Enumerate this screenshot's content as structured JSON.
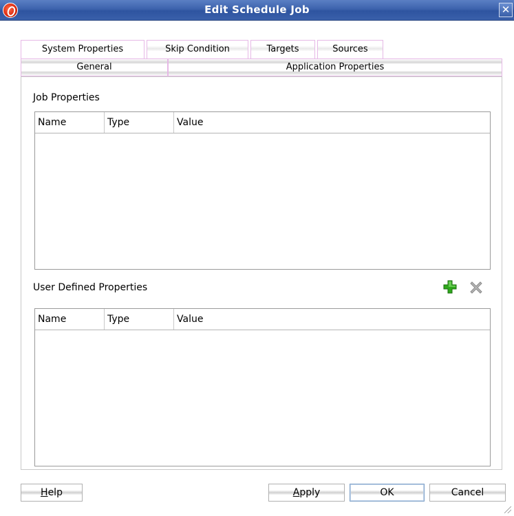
{
  "window": {
    "title": "Edit Schedule Job",
    "close_glyph": "✕",
    "app_icon": "oracle-logo-icon"
  },
  "tabs_row1": [
    {
      "label": "System Properties",
      "active": true
    },
    {
      "label": "Skip Condition",
      "active": false
    },
    {
      "label": "Targets",
      "active": false
    },
    {
      "label": "Sources",
      "active": false
    }
  ],
  "tabs_row2": [
    {
      "label": "General",
      "active": false
    },
    {
      "label": "Application Properties",
      "active": false
    }
  ],
  "job_properties": {
    "label": "Job Properties",
    "columns": [
      "Name",
      "Type",
      "Value"
    ],
    "rows": []
  },
  "user_defined_properties": {
    "label": "User Defined Properties",
    "columns": [
      "Name",
      "Type",
      "Value"
    ],
    "rows": [],
    "add_icon": "add-icon",
    "delete_icon": "delete-icon"
  },
  "buttons": {
    "help_mnemonic": "H",
    "help_rest": "elp",
    "apply_mnemonic": "A",
    "apply_rest": "pply",
    "ok": "OK",
    "cancel": "Cancel"
  },
  "colors": {
    "titlebar": "#3d63ad",
    "tab_border": "#e6b8e6",
    "add_icon_green": "#2fa81c",
    "delete_icon_gray": "#9a9a9a"
  }
}
